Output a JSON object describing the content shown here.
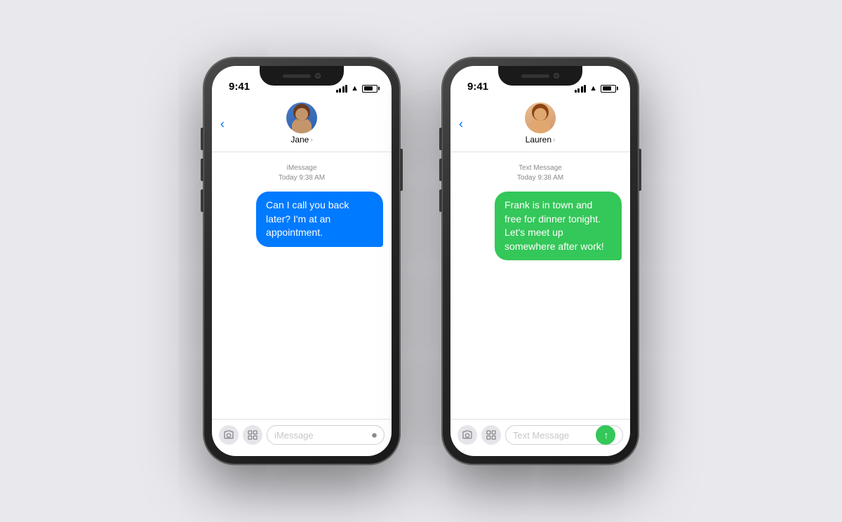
{
  "phone1": {
    "time": "9:41",
    "contact": {
      "name": "Jane",
      "avatar_type": "jane"
    },
    "timestamp": "iMessage\nToday 9:38 AM",
    "message": "Can I call you back later? I'm at an appointment.",
    "message_type": "blue",
    "input_placeholder": "iMessage",
    "back_label": "‹"
  },
  "phone2": {
    "time": "9:41",
    "contact": {
      "name": "Lauren",
      "avatar_type": "lauren"
    },
    "timestamp": "Text Message\nToday 9:38 AM",
    "message": "Frank is in town and free for dinner tonight. Let's meet up somewhere after work!",
    "message_type": "green",
    "input_placeholder": "Text Message",
    "back_label": "‹"
  }
}
